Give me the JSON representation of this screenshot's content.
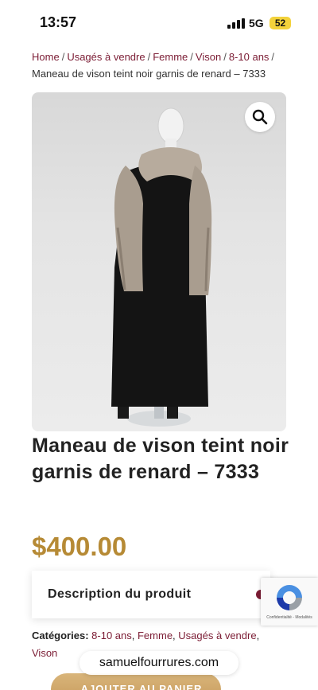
{
  "status": {
    "time": "13:57",
    "network": "5G",
    "battery": "52"
  },
  "breadcrumb": {
    "items": [
      "Home",
      "Usagés à vendre",
      "Femme",
      "Vison",
      "8-10 ans"
    ],
    "current": "Maneau de vison teint noir garnis de renard – 7333"
  },
  "product": {
    "title": "Maneau de vison teint noir garnis de renard – 7333",
    "price": "$400.00"
  },
  "description": {
    "label": "Description du produit"
  },
  "categories": {
    "label": "Catégories:",
    "items": [
      "8-10 ans",
      "Femme",
      "Usagés à vendre",
      "Vison"
    ]
  },
  "recaptcha": {
    "text": "Confidentialité - Modalités"
  },
  "browser": {
    "url": "samuelfourrures.com"
  },
  "cart": {
    "button_label": "AJOUTER AU PANIER"
  },
  "colors": {
    "accent": "#7b1c34",
    "price": "#b68a35",
    "button": "#c6995a"
  }
}
